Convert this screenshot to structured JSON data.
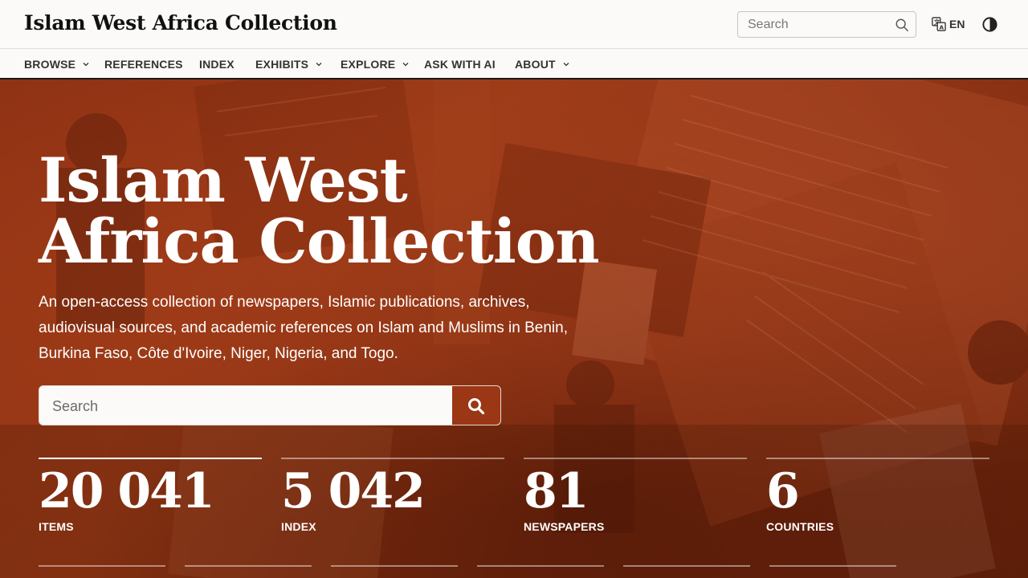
{
  "header": {
    "site_title": "Islam West Africa Collection",
    "search_placeholder": "Search",
    "language": "EN"
  },
  "nav": {
    "items": [
      {
        "label": "BROWSE",
        "dropdown": true
      },
      {
        "label": "REFERENCES",
        "dropdown": false
      },
      {
        "label": "INDEX",
        "dropdown": false
      },
      {
        "label": "EXHIBITS",
        "dropdown": true
      },
      {
        "label": "EXPLORE",
        "dropdown": true
      },
      {
        "label": "ASK WITH AI",
        "dropdown": false
      },
      {
        "label": "ABOUT",
        "dropdown": true
      }
    ]
  },
  "hero": {
    "title_line1": "Islam West",
    "title_line2": "Africa Collection",
    "description": "An open-access collection of newspapers, Islamic publications, archives, audiovisual sources, and academic references on Islam and Muslims in Benin, Burkina Faso, Côte d'Ivoire, Niger, Nigeria, and Togo.",
    "search_placeholder": "Search",
    "stats": [
      {
        "value": "20 041",
        "label": "ITEMS"
      },
      {
        "value": "5 042",
        "label": "INDEX"
      },
      {
        "value": "81",
        "label": "NEWSPAPERS"
      },
      {
        "value": "6",
        "label": "COUNTRIES"
      }
    ]
  },
  "colors": {
    "accent": "#9b3714",
    "hero_overlay": "#8e3315",
    "header_bg": "#fbfaf8",
    "text_dark": "#111111"
  },
  "icons": {
    "search": "search-icon",
    "translate": "translate-icon",
    "theme": "contrast-icon",
    "chevron": "chevron-down-icon"
  }
}
